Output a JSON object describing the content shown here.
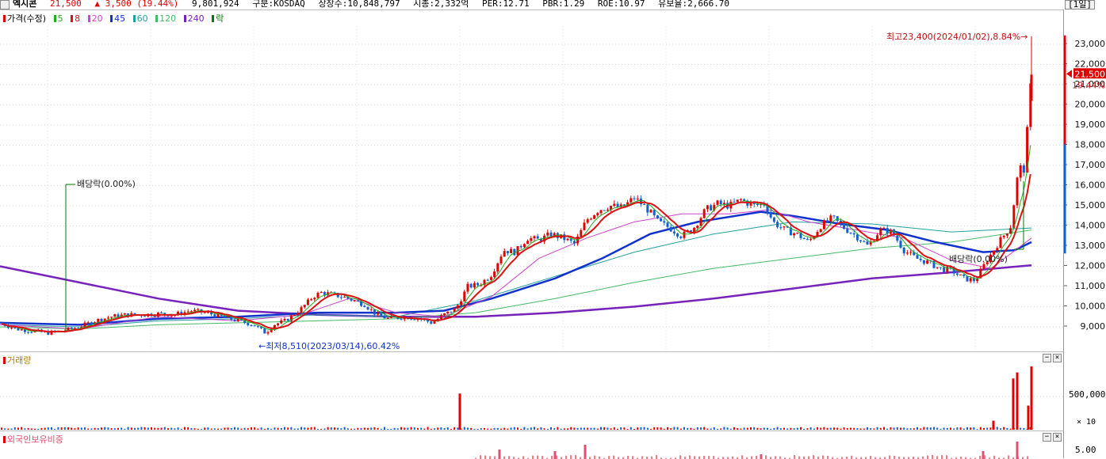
{
  "header": {
    "name": "엑시콘",
    "price": "21,500",
    "change": "▲ 3,500 (19.44%)",
    "volume": "9,801,924",
    "market": "구분:KOSDAQ",
    "shares": "상장수:10,848,797",
    "mcap": "시총:2,332억",
    "per": "PER:12.71",
    "pbr": "PBR:1.29",
    "roe": "ROE:10.97",
    "float": "유보율:2,666.70",
    "period": "[1일]"
  },
  "legend": {
    "price": "가격(수정)",
    "ma": [
      "5",
      "8",
      "20",
      "45",
      "60",
      "120",
      "240"
    ],
    "ex": "락"
  },
  "colors": {
    "up": "#e00000",
    "down": "#1060d0",
    "ma5": "#22aa22",
    "ma8": "#dd1111",
    "ma20": "#cc44cc",
    "ma45": "#1133cc",
    "ma60": "#22a0a0",
    "ma120": "#44bb66",
    "ma240": "#7722bb",
    "annot": "#007a00"
  },
  "annotations": {
    "high": "최고23,400(2024/01/02),8.84%",
    "low": "최저8,510(2023/03/14),60.42%",
    "div1": "배당락(0.00%)",
    "div2": "배당락(0.00%)"
  },
  "volume_pane": {
    "title": "거래량",
    "tick": "500,000",
    "scale": "× 10"
  },
  "foreign_pane": {
    "title": "외국인보유비중",
    "tick": "5.00"
  },
  "chart_data": {
    "type": "candlestick",
    "y_ticks": [
      23000,
      22000,
      21000,
      20000,
      19000,
      18000,
      17000,
      16000,
      15000,
      14000,
      13000,
      12000,
      11000,
      10000,
      9000
    ],
    "y_tick_labels": [
      "23,000",
      "22,000",
      "21,000",
      "20,000",
      "19,000",
      "18,000",
      "17,000",
      "16,000",
      "15,000",
      "14,000",
      "13,000",
      "12,000",
      "11,000",
      "10,000",
      "9,000"
    ],
    "last_price": "21,500",
    "last_pct": "19.44%",
    "high": 23400,
    "low": 8510,
    "close_path": [
      [
        0,
        9200
      ],
      [
        20,
        8900
      ],
      [
        40,
        8800
      ],
      [
        60,
        8700
      ],
      [
        80,
        8800
      ],
      [
        100,
        9000
      ],
      [
        120,
        9300
      ],
      [
        140,
        9500
      ],
      [
        160,
        9600
      ],
      [
        180,
        9600
      ],
      [
        200,
        9650
      ],
      [
        220,
        9600
      ],
      [
        240,
        9800
      ],
      [
        260,
        9700
      ],
      [
        280,
        9500
      ],
      [
        300,
        9300
      ],
      [
        320,
        9100
      ],
      [
        335,
        8700
      ],
      [
        345,
        9100
      ],
      [
        360,
        9300
      ],
      [
        380,
        9900
      ],
      [
        395,
        10500
      ],
      [
        405,
        10700
      ],
      [
        420,
        10600
      ],
      [
        440,
        10400
      ],
      [
        460,
        10100
      ],
      [
        475,
        9600
      ],
      [
        490,
        9400
      ],
      [
        510,
        9500
      ],
      [
        530,
        9400
      ],
      [
        545,
        9200
      ],
      [
        560,
        9600
      ],
      [
        575,
        9900
      ],
      [
        590,
        11000
      ],
      [
        605,
        11100
      ],
      [
        620,
        11600
      ],
      [
        635,
        12800
      ],
      [
        650,
        12700
      ],
      [
        665,
        13400
      ],
      [
        680,
        13300
      ],
      [
        695,
        13600
      ],
      [
        710,
        13400
      ],
      [
        725,
        13100
      ],
      [
        740,
        14300
      ],
      [
        755,
        14800
      ],
      [
        770,
        15000
      ],
      [
        785,
        14900
      ],
      [
        800,
        15400
      ],
      [
        815,
        14900
      ],
      [
        830,
        14200
      ],
      [
        845,
        13900
      ],
      [
        860,
        13500
      ],
      [
        875,
        13900
      ],
      [
        890,
        14800
      ],
      [
        905,
        15100
      ],
      [
        920,
        15000
      ],
      [
        935,
        15300
      ],
      [
        950,
        15000
      ],
      [
        965,
        15100
      ],
      [
        975,
        14200
      ],
      [
        990,
        13800
      ],
      [
        1005,
        13600
      ],
      [
        1020,
        13200
      ],
      [
        1035,
        14000
      ],
      [
        1050,
        14400
      ],
      [
        1065,
        13900
      ],
      [
        1080,
        13500
      ],
      [
        1095,
        13000
      ],
      [
        1110,
        13800
      ],
      [
        1125,
        13700
      ],
      [
        1140,
        12800
      ],
      [
        1155,
        12400
      ],
      [
        1170,
        12200
      ],
      [
        1185,
        11900
      ],
      [
        1200,
        11800
      ],
      [
        1215,
        11400
      ],
      [
        1230,
        11300
      ],
      [
        1245,
        12300
      ],
      [
        1260,
        13200
      ],
      [
        1275,
        14000
      ],
      [
        1285,
        16900
      ],
      [
        1292,
        16800
      ],
      [
        1301,
        21500
      ]
    ],
    "ma_series": [
      {
        "key": "ma240",
        "points": [
          [
            0,
            12000
          ],
          [
            100,
            11200
          ],
          [
            200,
            10400
          ],
          [
            300,
            9800
          ],
          [
            400,
            9600
          ],
          [
            500,
            9500
          ],
          [
            600,
            9500
          ],
          [
            700,
            9700
          ],
          [
            800,
            10000
          ],
          [
            900,
            10400
          ],
          [
            1000,
            10900
          ],
          [
            1100,
            11400
          ],
          [
            1200,
            11700
          ],
          [
            1301,
            12050
          ]
        ]
      },
      {
        "key": "ma120",
        "points": [
          [
            0,
            9000
          ],
          [
            100,
            8900
          ],
          [
            200,
            9100
          ],
          [
            300,
            9200
          ],
          [
            400,
            9300
          ],
          [
            500,
            9400
          ],
          [
            600,
            9700
          ],
          [
            700,
            10400
          ],
          [
            800,
            11200
          ],
          [
            900,
            11900
          ],
          [
            1000,
            12400
          ],
          [
            1100,
            12900
          ],
          [
            1200,
            13200
          ],
          [
            1301,
            13800
          ]
        ]
      },
      {
        "key": "ma60",
        "points": [
          [
            0,
            9100
          ],
          [
            100,
            9000
          ],
          [
            200,
            9300
          ],
          [
            300,
            9400
          ],
          [
            400,
            9600
          ],
          [
            500,
            9500
          ],
          [
            600,
            10300
          ],
          [
            700,
            11500
          ],
          [
            800,
            12700
          ],
          [
            900,
            13600
          ],
          [
            1000,
            14200
          ],
          [
            1100,
            14100
          ],
          [
            1200,
            13700
          ],
          [
            1301,
            13900
          ]
        ]
      },
      {
        "key": "ma45",
        "points": [
          [
            0,
            9200
          ],
          [
            100,
            9100
          ],
          [
            200,
            9400
          ],
          [
            300,
            9500
          ],
          [
            400,
            9700
          ],
          [
            500,
            9700
          ],
          [
            560,
            9800
          ],
          [
            620,
            10400
          ],
          [
            700,
            11400
          ],
          [
            760,
            12400
          ],
          [
            820,
            13600
          ],
          [
            880,
            14200
          ],
          [
            960,
            14700
          ],
          [
            1000,
            14500
          ],
          [
            1060,
            14100
          ],
          [
            1120,
            13800
          ],
          [
            1180,
            13200
          ],
          [
            1240,
            12700
          ],
          [
            1280,
            12800
          ],
          [
            1301,
            13200
          ]
        ]
      },
      {
        "key": "ma20",
        "points": [
          [
            0,
            9100
          ],
          [
            100,
            8900
          ],
          [
            200,
            9500
          ],
          [
            300,
            9300
          ],
          [
            380,
            9600
          ],
          [
            440,
            10400
          ],
          [
            500,
            9700
          ],
          [
            560,
            9500
          ],
          [
            620,
            10500
          ],
          [
            680,
            12400
          ],
          [
            740,
            13400
          ],
          [
            800,
            14200
          ],
          [
            860,
            14600
          ],
          [
            920,
            14600
          ],
          [
            970,
            14800
          ],
          [
            1020,
            14200
          ],
          [
            1080,
            13800
          ],
          [
            1140,
            13400
          ],
          [
            1200,
            12300
          ],
          [
            1250,
            11900
          ],
          [
            1301,
            13400
          ]
        ]
      }
    ],
    "volume": [
      [
        580,
        1200
      ],
      [
        1253,
        300
      ],
      [
        1278,
        1700
      ],
      [
        1283,
        1900
      ],
      [
        1297,
        800
      ],
      [
        1301,
        2100
      ]
    ],
    "foreign": [
      [
        630,
        5.4
      ],
      [
        700,
        5.3
      ],
      [
        738,
        5.7
      ],
      [
        960,
        5.1
      ],
      [
        1240,
        5.3
      ],
      [
        1283,
        5.9
      ]
    ]
  }
}
